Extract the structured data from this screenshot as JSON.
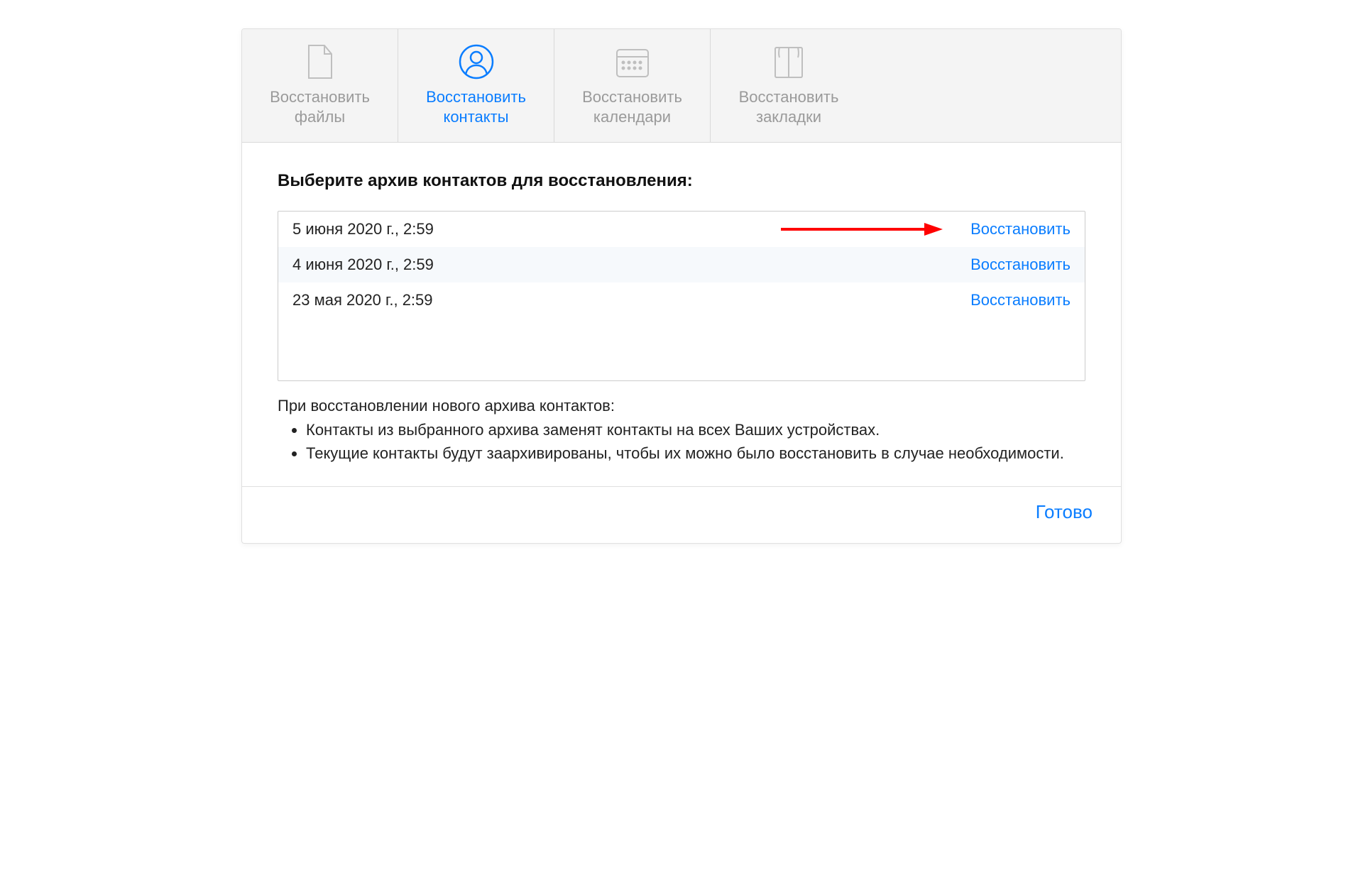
{
  "tabs": [
    {
      "label": "Восстановить\nфайлы",
      "active": false
    },
    {
      "label": "Восстановить\nконтакты",
      "active": true
    },
    {
      "label": "Восстановить\nкалендари",
      "active": false
    },
    {
      "label": "Восстановить\nзакладки",
      "active": false
    }
  ],
  "heading": "Выберите архив контактов для восстановления:",
  "archives": [
    {
      "date": "5 июня 2020 г., 2:59",
      "action": "Восстановить"
    },
    {
      "date": "4 июня 2020 г., 2:59",
      "action": "Восстановить"
    },
    {
      "date": "23 мая 2020 г., 2:59",
      "action": "Восстановить"
    }
  ],
  "notes": {
    "title": "При восстановлении нового архива контактов:",
    "items": [
      "Контакты из выбранного архива заменят контакты на всех Ваших устройствах.",
      "Текущие контакты будут заархивированы, чтобы их можно было восстановить в случае необходимости."
    ]
  },
  "footer": {
    "done": "Готово"
  },
  "colors": {
    "accent": "#0a7dff",
    "arrow": "#ff0000"
  }
}
